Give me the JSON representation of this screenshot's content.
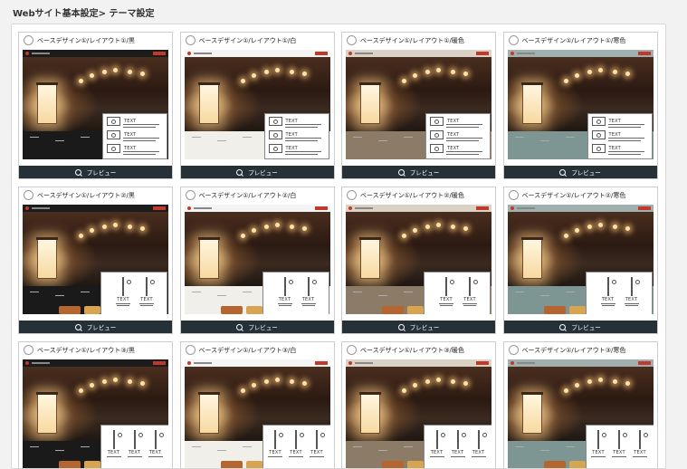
{
  "breadcrumb": "Webサイト基本設定> テーマ設定",
  "preview_label": "プレビュー",
  "overlay_text": "TEXT",
  "themes": [
    {
      "title": "ベースデザイン①/レイアウト①/黒",
      "variant": "black",
      "layout": 1
    },
    {
      "title": "ベースデザイン①/レイアウト①/白",
      "variant": "white",
      "layout": 1
    },
    {
      "title": "ベースデザイン①/レイアウト①/暖色",
      "variant": "warm",
      "layout": 1
    },
    {
      "title": "ベースデザイン①/レイアウト①/寒色",
      "variant": "cool",
      "layout": 1
    },
    {
      "title": "ベースデザイン①/レイアウト②/黒",
      "variant": "black",
      "layout": 2
    },
    {
      "title": "ベースデザイン①/レイアウト②/白",
      "variant": "white",
      "layout": 2
    },
    {
      "title": "ベースデザイン①/レイアウト②/暖色",
      "variant": "warm",
      "layout": 2
    },
    {
      "title": "ベースデザイン①/レイアウト②/寒色",
      "variant": "cool",
      "layout": 2
    },
    {
      "title": "ベースデザイン①/レイアウト③/黒",
      "variant": "black",
      "layout": 3
    },
    {
      "title": "ベースデザイン①/レイアウト③/白",
      "variant": "white",
      "layout": 3
    },
    {
      "title": "ベースデザイン①/レイアウト③/暖色",
      "variant": "warm",
      "layout": 3
    },
    {
      "title": "ベースデザイン①/レイアウト③/寒色",
      "variant": "cool",
      "layout": 3
    }
  ],
  "variant_colors": {
    "black": {
      "bar": "#1c1c1c",
      "band": "#1a1a1a"
    },
    "white": {
      "bar": "#f4f4f4",
      "band": "#f1efe9"
    },
    "warm": {
      "bar": "#d9d2c5",
      "band": "#8c7b66"
    },
    "cool": {
      "bar": "#9fb0ae",
      "band": "#7d9593"
    }
  },
  "colors": {
    "preview_bar": "#253137",
    "accent": "#c0392b"
  }
}
